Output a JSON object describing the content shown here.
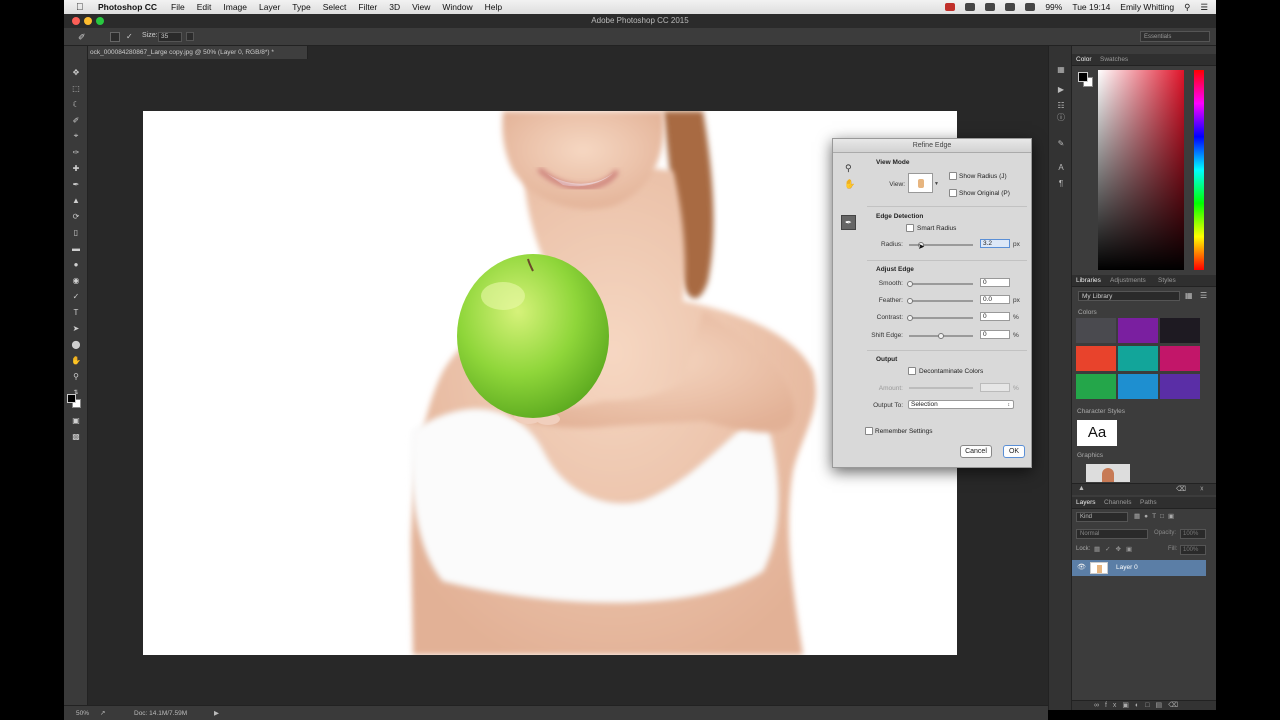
{
  "menubar": {
    "app_name": "Photoshop CC",
    "items": [
      "File",
      "Edit",
      "Image",
      "Layer",
      "Type",
      "Select",
      "Filter",
      "3D",
      "View",
      "Window",
      "Help"
    ],
    "battery": "99%",
    "clock": "Tue 19:14",
    "user": "Emily Whitting"
  },
  "window": {
    "title": "Adobe Photoshop CC 2015"
  },
  "options": {
    "size_label": "Size:",
    "size_value": "35",
    "workspace": "Essentials"
  },
  "document": {
    "tab_title": "ock_000084280867_Large copy.jpg @ 50% (Layer 0, RGB/8*) *",
    "zoom": "50%",
    "doc_info": "Doc: 14.1M/7.59M"
  },
  "dialog": {
    "title": "Refine Edge",
    "view_mode_heading": "View Mode",
    "view_label": "View:",
    "show_radius": "Show Radius (J)",
    "show_original": "Show Original (P)",
    "edge_detection_heading": "Edge Detection",
    "smart_radius": "Smart Radius",
    "radius_label": "Radius:",
    "radius_value": "3.2",
    "radius_unit": "px",
    "adjust_edge_heading": "Adjust Edge",
    "smooth_label": "Smooth:",
    "smooth_value": "0",
    "feather_label": "Feather:",
    "feather_value": "0.0",
    "feather_unit": "px",
    "contrast_label": "Contrast:",
    "contrast_value": "0",
    "contrast_unit": "%",
    "shift_edge_label": "Shift Edge:",
    "shift_edge_value": "0",
    "shift_edge_unit": "%",
    "output_heading": "Output",
    "decontaminate": "Decontaminate Colors",
    "amount_label": "Amount:",
    "amount_unit": "%",
    "output_to_label": "Output To:",
    "output_to_value": "Selection",
    "remember": "Remember Settings",
    "cancel": "Cancel",
    "ok": "OK"
  },
  "panels": {
    "color_tabs": [
      "Color",
      "Swatches"
    ],
    "lib_tabs": [
      "Libraries",
      "Adjustments",
      "Styles"
    ],
    "library_name": "My Library",
    "colors_heading": "Colors",
    "swatches": [
      "#4a4a4f",
      "#7a1fa0",
      "#1e1a22",
      "#e8432c",
      "#12a59a",
      "#c21669",
      "#24a64a",
      "#1e8fd0",
      "#5a2ea6"
    ],
    "char_styles_heading": "Character Styles",
    "char_style_sample": "Aa",
    "graphics_heading": "Graphics",
    "layer_tabs": [
      "Layers",
      "Channels",
      "Paths"
    ],
    "kind_label": "Kind",
    "blend_mode": "Normal",
    "opacity_label": "Opacity:",
    "opacity_value": "100%",
    "lock_label": "Lock:",
    "fill_label": "Fill:",
    "fill_value": "100%",
    "layer_name": "Layer 0"
  },
  "colors": {
    "accent_layer": "#5b7ea6",
    "apple_green": "#8fd63a",
    "color_picker_hue": "#e0142a"
  }
}
